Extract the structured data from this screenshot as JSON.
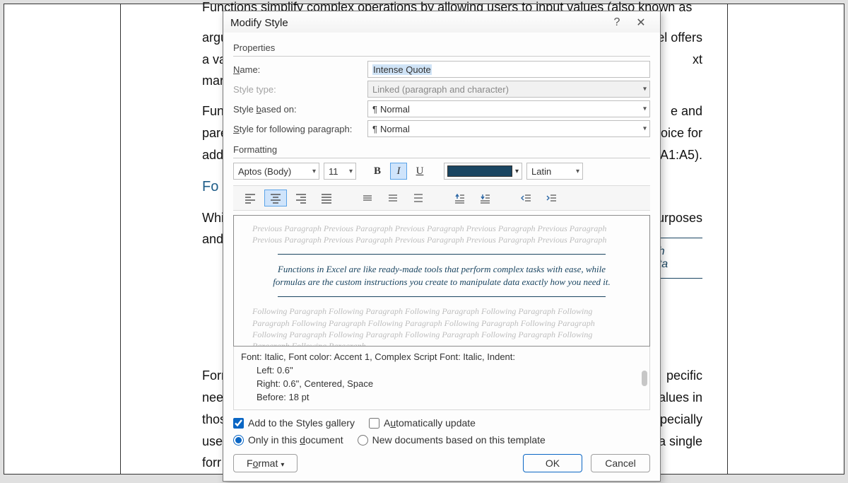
{
  "background": {
    "para1_line1": "Functions simplify complex operations by allowing users to input values (also known as",
    "para1_line2": "argu",
    "para1_line2b": "Excel offers",
    "para1_line3a": "a va",
    "para1_line3b": "xt",
    "para1_line4": "mar",
    "para2_a": "Fun",
    "para2_b": "e and",
    "para3_a": "pare",
    "para3_b": "hoice for",
    "para4_a": "add",
    "para4_b": "A1:A5).",
    "heading": "Fo",
    "para5_a": "Whi",
    "para5_b": "nt purposes",
    "para6_a": "and",
    "aside1": "th",
    "aside2": "ata",
    "para7_a": "Forr",
    "para7_b": "pecific",
    "para8_a": "nee",
    "para8_b": "alues in",
    "para9_a": "thos",
    "para9_b": "specially",
    "para10_a": "use",
    "para10_b": "a single",
    "para11_a": "forr"
  },
  "dialog": {
    "title": "Modify Style",
    "help": "?",
    "close": "✕",
    "properties_label": "Properties",
    "name_label_pre": "N",
    "name_label_post": "ame:",
    "name_value": "Intense Quote",
    "styletype_label": "Style type:",
    "styletype_value": "Linked (paragraph and character)",
    "basedon_pre": "Style ",
    "basedon_u": "b",
    "basedon_post": "ased on:",
    "basedon_value": "Normal",
    "following_pre": "",
    "following_u": "S",
    "following_post": "tyle for following paragraph:",
    "following_value": "Normal",
    "formatting_label": "Formatting",
    "font": "Aptos (Body)",
    "size": "11",
    "bold": "B",
    "italic": "I",
    "underline": "U",
    "script": "Latin",
    "preview_ghost_prev": "Previous Paragraph Previous Paragraph Previous Paragraph Previous Paragraph Previous Paragraph Previous Paragraph Previous Paragraph Previous Paragraph Previous Paragraph Previous Paragraph",
    "preview_quote": "Functions in Excel are like ready-made tools that perform complex tasks with ease, while formulas are the custom instructions you create to manipulate data exactly how you need it.",
    "preview_ghost_next": "Following Paragraph Following Paragraph Following Paragraph Following Paragraph Following Paragraph Following Paragraph Following Paragraph Following Paragraph Following Paragraph Following Paragraph Following Paragraph Following Paragraph Following Paragraph Following Paragraph Following Paragraph",
    "desc_line1": "Font: Italic, Font color: Accent 1, Complex Script Font: Italic, Indent:",
    "desc_line2": "Left:  0.6\"",
    "desc_line3": "Right:  0.6\", Centered, Space",
    "desc_line4": "Before:  18 pt",
    "add_gallery": "Add to the Styles gallery",
    "auto_update_pre": "A",
    "auto_update_u": "u",
    "auto_update_post": "tomatically update",
    "only_doc_pre": "Only in this ",
    "only_doc_u": "d",
    "only_doc_post": "ocument",
    "new_docs": "New documents based on this template",
    "format_btn_pre": "F",
    "format_btn_u": "o",
    "format_btn_post": "rmat",
    "ok": "OK",
    "cancel": "Cancel",
    "color_swatch": "#1a4561"
  }
}
